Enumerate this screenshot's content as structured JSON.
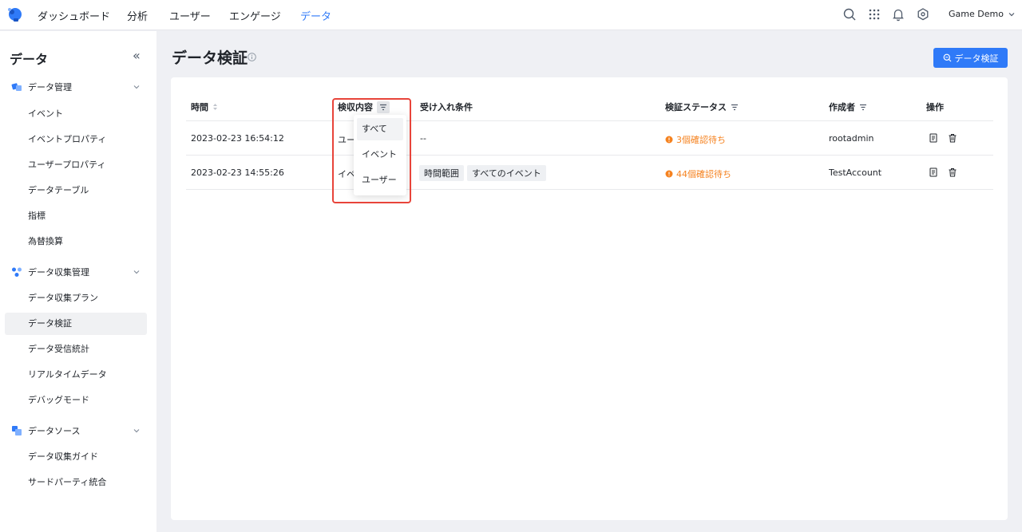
{
  "topnav": {
    "items": [
      "ダッシュボード",
      "分析",
      "ユーザー",
      "エンゲージ",
      "データ"
    ],
    "active_index": 4,
    "workspace": "Game Demo"
  },
  "sidebar": {
    "title": "データ",
    "collapse_glyph": "«",
    "groups": [
      {
        "label": "データ管理",
        "icon": "cubes-icon",
        "items": [
          "イベント",
          "イベントプロパティ",
          "ユーザープロパティ",
          "データテーブル",
          "指標",
          "為替換算"
        ]
      },
      {
        "label": "データ収集管理",
        "icon": "nodes-icon",
        "items": [
          "データ収集プラン",
          "データ検証",
          "データ受信統計",
          "リアルタイムデータ",
          "デバッグモード"
        ]
      },
      {
        "label": "データソース",
        "icon": "layers-icon",
        "items": [
          "データ収集ガイド",
          "サードパーティ統合"
        ]
      }
    ],
    "active_item": "データ検証"
  },
  "page": {
    "title": "データ検証",
    "primary_button": "データ検証"
  },
  "table": {
    "columns": [
      "時間",
      "検収内容",
      "受け入れ条件",
      "検証ステータス",
      "作成者",
      "操作"
    ],
    "rows": [
      {
        "time": "2023-02-23 16:54:12",
        "content": "ユー",
        "conditions": [
          "--"
        ],
        "status": "3個確認待ち",
        "creator": "rootadmin"
      },
      {
        "time": "2023-02-23 14:55:26",
        "content": "イベ",
        "conditions": [
          "時間範囲",
          "すべてのイベント"
        ],
        "status": "44個確認待ち",
        "creator": "TestAccount"
      }
    ]
  },
  "filter_dropdown": {
    "options": [
      "すべて",
      "イベント",
      "ユーザー"
    ],
    "selected_index": 0
  },
  "colors": {
    "accent": "#2f7af8",
    "warning": "#f5821f",
    "highlight": "#e8443a"
  }
}
